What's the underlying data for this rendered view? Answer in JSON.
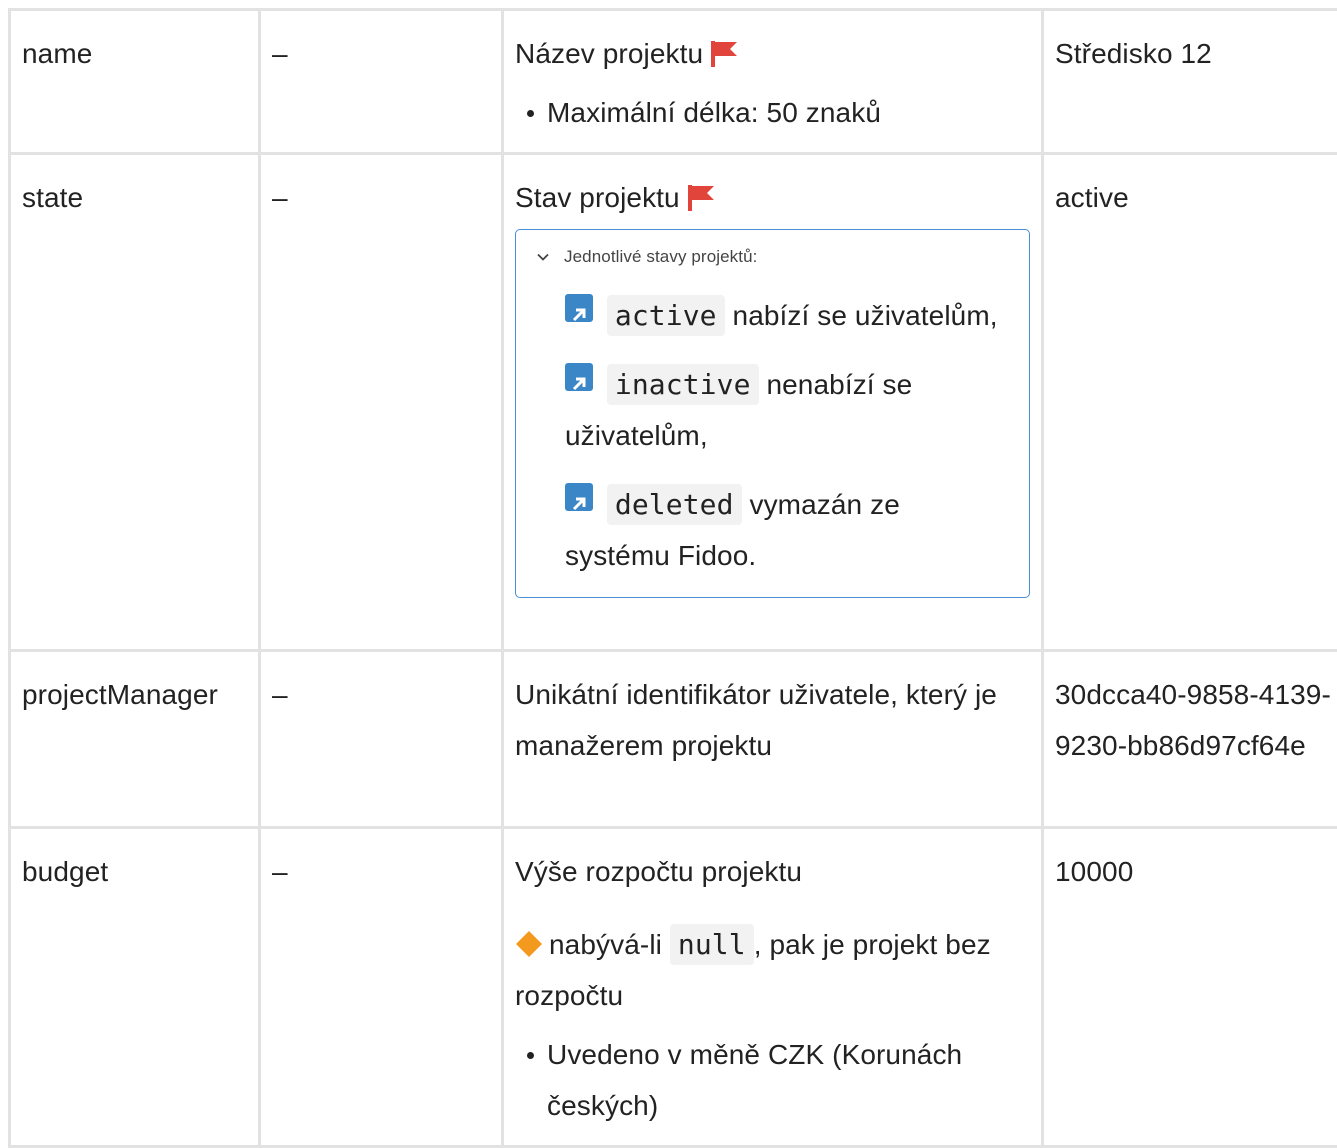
{
  "rows": [
    {
      "name": "name",
      "required": "–",
      "description": "Název projektu",
      "bullets": [
        "Maximální délka: 50 znaků"
      ],
      "example": "Středisko 12"
    },
    {
      "name": "state",
      "required": "–",
      "description": "Stav projektu",
      "details_summary": "Jednotlivé stavy projektů:",
      "states": [
        {
          "code": "active",
          "text": "nabízí se uživatelům,"
        },
        {
          "code": "inactive",
          "text": "nenabízí se uživatelům,"
        },
        {
          "code": "deleted",
          "text": "vymazán ze systému Fidoo."
        }
      ],
      "example": "active"
    },
    {
      "name": "projectManager",
      "required": "–",
      "description": "Unikátní identifikátor uživatele, který je manažerem projektu",
      "example": "30dcca40-9858-4139-9230-bb86d97cf64e"
    },
    {
      "name": "budget",
      "required": "–",
      "description": "Výše rozpočtu projektu",
      "note_pre": "nabývá-li",
      "note_code": "null",
      "note_post": ", pak je projekt bez rozpočtu",
      "bullets": [
        "Uvedeno v měně CZK (Korunách českých)"
      ],
      "example": "10000"
    }
  ],
  "colors": {
    "required_flag": "#e0443a",
    "link_icon_bg": "#3a86c6",
    "warning_diamond": "#f39a1e",
    "details_border": "#4a8ed8",
    "table_border": "#e2e2e2"
  },
  "icons": {
    "required": "flag-icon",
    "state_link": "external-link-icon",
    "warning": "diamond-icon",
    "collapse": "chevron-down-icon"
  }
}
